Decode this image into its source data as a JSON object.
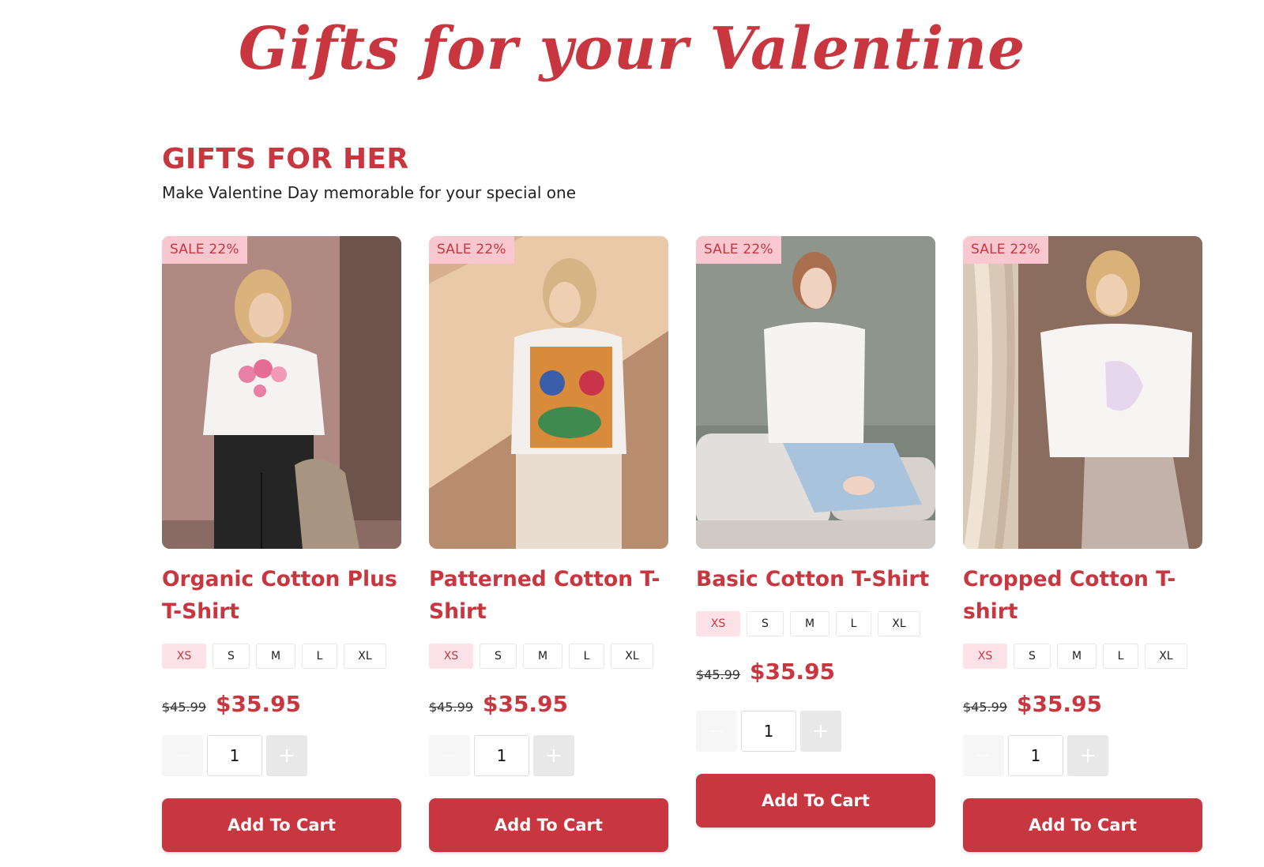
{
  "hero": {
    "title": "Gifts for your Valentine"
  },
  "section": {
    "title": "GIFTS FOR HER",
    "subtitle": "Make Valentine Day memorable for your special one"
  },
  "colors": {
    "accent": "#c8363f",
    "badge_bg": "#f8c7cf",
    "selected_size_bg": "#fde3e7"
  },
  "sizes": [
    "XS",
    "S",
    "M",
    "L",
    "XL"
  ],
  "products": [
    {
      "badge": "SALE 22%",
      "title": "Organic Cotton Plus T-Shirt",
      "selected_size": "XS",
      "old_price": "$45.99",
      "price": "$35.95",
      "quantity": "1",
      "minus": "−",
      "plus": "+",
      "cta": "Add To Cart",
      "image_icon": "woman-floral-tshirt-photo"
    },
    {
      "badge": "SALE 22%",
      "title": "Patterned Cotton T-Shirt",
      "selected_size": "XS",
      "old_price": "$45.99",
      "price": "$35.95",
      "quantity": "1",
      "minus": "−",
      "plus": "+",
      "cta": "Add To Cart",
      "image_icon": "woman-parrot-tshirt-photo"
    },
    {
      "badge": "SALE 22%",
      "title": "Basic Cotton T-Shirt",
      "selected_size": "XS",
      "old_price": "$45.99",
      "price": "$35.95",
      "quantity": "1",
      "minus": "−",
      "plus": "+",
      "cta": "Add To Cart",
      "image_icon": "woman-white-tshirt-photo"
    },
    {
      "badge": "SALE 22%",
      "title": "Cropped Cotton T-shirt",
      "selected_size": "XS",
      "old_price": "$45.99",
      "price": "$35.95",
      "quantity": "1",
      "minus": "−",
      "plus": "+",
      "cta": "Add To Cart",
      "image_icon": "woman-lily-tshirt-photo"
    }
  ]
}
